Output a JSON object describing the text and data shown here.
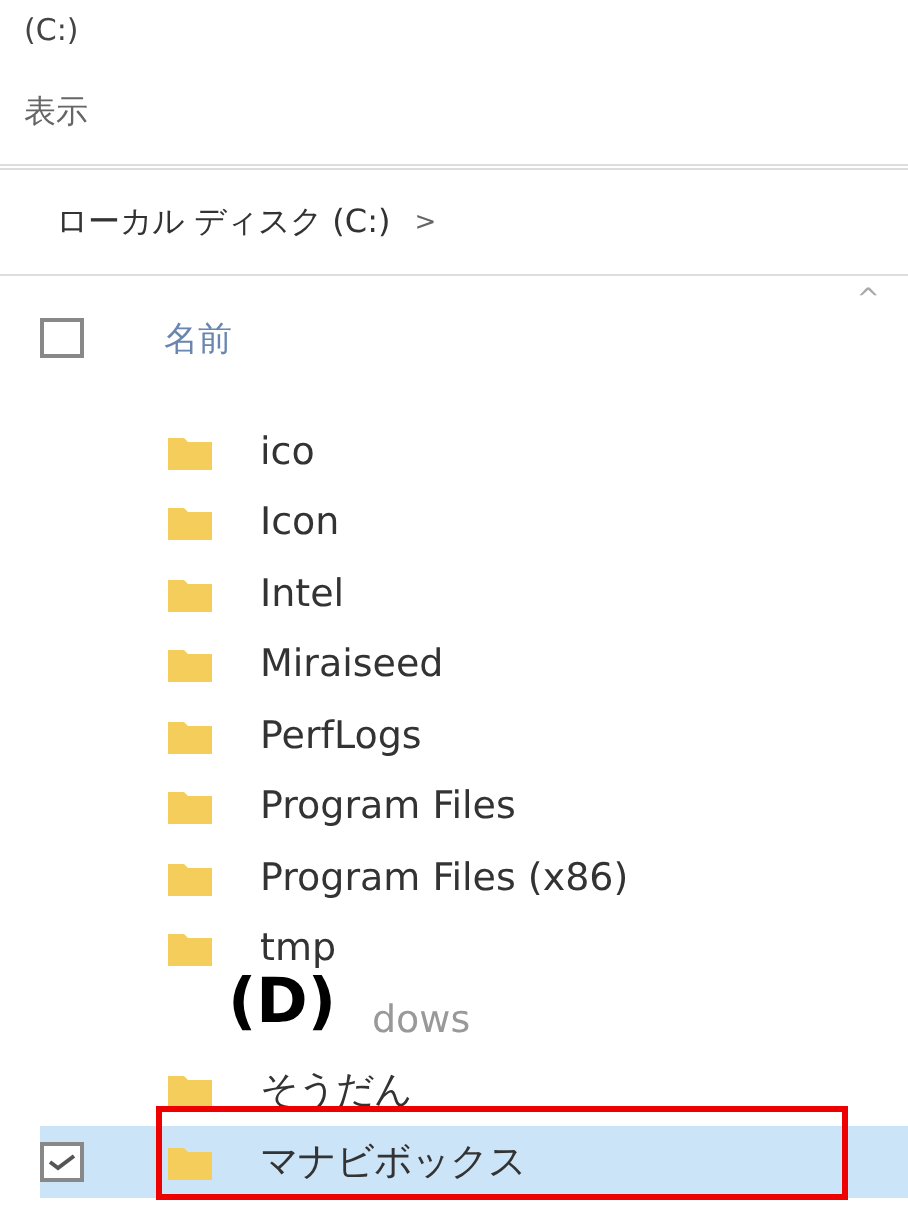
{
  "window": {
    "title": "(C:)"
  },
  "ribbon": {
    "tab": "表示"
  },
  "breadcrumb": {
    "path": "ローカル ディスク (C:)",
    "separator": ">"
  },
  "header": {
    "all_checked": false,
    "column": "名前",
    "sort": "^"
  },
  "rows": [
    {
      "kind": "folder",
      "name": "ico",
      "selected": false
    },
    {
      "kind": "folder",
      "name": "Icon",
      "selected": false
    },
    {
      "kind": "folder",
      "name": "Intel",
      "selected": false
    },
    {
      "kind": "folder",
      "name": "Miraiseed",
      "selected": false
    },
    {
      "kind": "folder",
      "name": "PerfLogs",
      "selected": false
    },
    {
      "kind": "folder",
      "name": "Program Files",
      "selected": false
    },
    {
      "kind": "folder",
      "name": "Program Files (x86)",
      "selected": false
    },
    {
      "kind": "folder",
      "name": "tmp",
      "selected": false
    },
    {
      "kind": "covered",
      "name": "dows",
      "selected": false
    },
    {
      "kind": "folder",
      "name": "そうだん",
      "selected": false
    },
    {
      "kind": "folder",
      "name": "マナビボックス",
      "selected": true,
      "highlighted": true
    }
  ],
  "annotation": {
    "label": "(D)"
  }
}
